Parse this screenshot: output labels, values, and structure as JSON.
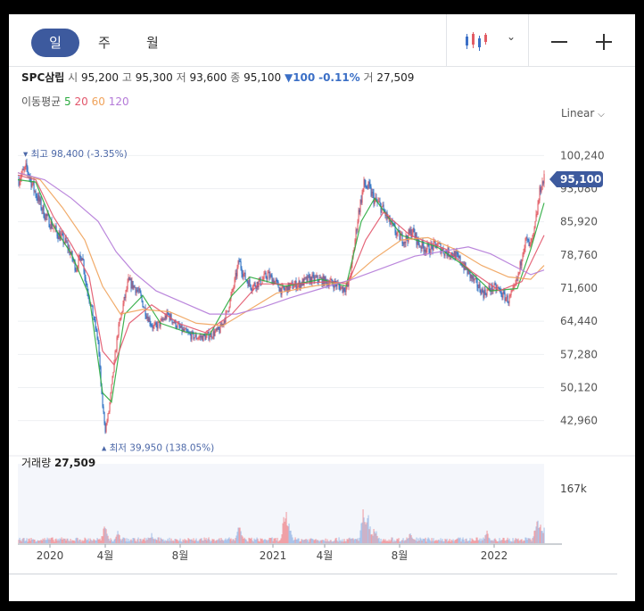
{
  "tabs": {
    "day": "일",
    "week": "주",
    "month": "월"
  },
  "icons": {
    "chart_type": "candlestick-icon",
    "chart_type_dropdown": "chevron-down-icon",
    "zoom_out": "minus-icon",
    "zoom_in": "plus-icon"
  },
  "header": {
    "name": "SPC삼립",
    "open_label": "시",
    "open": "95,200",
    "high_label": "고",
    "high": "95,300",
    "low_label": "저",
    "low": "93,600",
    "close_label": "종",
    "close": "95,100",
    "change_arrow": "▼",
    "change": "100",
    "change_pct": "-0.11%",
    "volume_label": "거",
    "volume": "27,509"
  },
  "moving_average": {
    "label": "이동평균",
    "periods": [
      "5",
      "20",
      "60",
      "120"
    ],
    "colors": [
      "#2bab3f",
      "#e2566b",
      "#f0a25a",
      "#b47ad8"
    ]
  },
  "scale": {
    "label": "Linear"
  },
  "colors": {
    "up": "#e25c64",
    "down": "#2b6fc2",
    "price_tag": "#3d5a9e",
    "tab_active": "#3d5a9e",
    "marker_text": "#4c68a8"
  },
  "chart_data": {
    "type": "candlestick",
    "x_axis_labels": [
      "2020",
      "4월",
      "8월",
      "2021",
      "4월",
      "8월",
      "2022"
    ],
    "y_axis_ticks": [
      100240,
      93080,
      85920,
      78760,
      71600,
      64440,
      57280,
      50120,
      42960
    ],
    "y_axis_tick_labels": [
      "100,240",
      "93,080",
      "85,920",
      "78,760",
      "71,600",
      "64,440",
      "57,280",
      "50,120",
      "42,960"
    ],
    "ylim": [
      37500,
      103000
    ],
    "current_price": 95100,
    "current_price_label": "95,100",
    "high_marker": {
      "value": 98400,
      "label": "최고",
      "value_label": "98,400",
      "pct": "(-3.35%)"
    },
    "low_marker": {
      "value": 39950,
      "label": "최저",
      "value_label": "39,950",
      "pct": "(138.05%)"
    },
    "close_path": [
      [
        0,
        95000
      ],
      [
        10,
        97500
      ],
      [
        18,
        93000
      ],
      [
        30,
        87500
      ],
      [
        42,
        84000
      ],
      [
        55,
        81000
      ],
      [
        65,
        76000
      ],
      [
        72,
        79000
      ],
      [
        76,
        73000
      ],
      [
        84,
        66000
      ],
      [
        90,
        60000
      ],
      [
        94,
        48000
      ],
      [
        98,
        41000
      ],
      [
        102,
        45000
      ],
      [
        106,
        52000
      ],
      [
        112,
        62000
      ],
      [
        118,
        68000
      ],
      [
        124,
        73000
      ],
      [
        130,
        72000
      ],
      [
        136,
        70500
      ],
      [
        144,
        66000
      ],
      [
        152,
        63000
      ],
      [
        160,
        64000
      ],
      [
        168,
        66000
      ],
      [
        176,
        64000
      ],
      [
        184,
        62500
      ],
      [
        192,
        61500
      ],
      [
        200,
        61000
      ],
      [
        208,
        61000
      ],
      [
        216,
        61500
      ],
      [
        226,
        62500
      ],
      [
        234,
        66000
      ],
      [
        242,
        72000
      ],
      [
        248,
        77500
      ],
      [
        254,
        74000
      ],
      [
        262,
        72000
      ],
      [
        272,
        73000
      ],
      [
        280,
        74500
      ],
      [
        288,
        73000
      ],
      [
        296,
        71000
      ],
      [
        306,
        72000
      ],
      [
        316,
        72500
      ],
      [
        326,
        73500
      ],
      [
        336,
        73500
      ],
      [
        346,
        73000
      ],
      [
        356,
        72500
      ],
      [
        364,
        71500
      ],
      [
        370,
        72000
      ],
      [
        374,
        76000
      ],
      [
        378,
        82000
      ],
      [
        382,
        88000
      ],
      [
        388,
        94000
      ],
      [
        394,
        93000
      ],
      [
        400,
        90500
      ],
      [
        408,
        89000
      ],
      [
        416,
        86000
      ],
      [
        426,
        83000
      ],
      [
        434,
        82000
      ],
      [
        442,
        84000
      ],
      [
        450,
        81000
      ],
      [
        460,
        80000
      ],
      [
        470,
        81000
      ],
      [
        478,
        79500
      ],
      [
        488,
        79000
      ],
      [
        496,
        77500
      ],
      [
        506,
        74500
      ],
      [
        514,
        72500
      ],
      [
        522,
        70500
      ],
      [
        530,
        71500
      ],
      [
        538,
        71500
      ],
      [
        544,
        70000
      ],
      [
        550,
        69000
      ],
      [
        556,
        71000
      ],
      [
        562,
        75000
      ],
      [
        566,
        80000
      ],
      [
        570,
        82000
      ],
      [
        574,
        80500
      ],
      [
        578,
        82500
      ],
      [
        582,
        88000
      ],
      [
        586,
        93500
      ],
      [
        590,
        95100
      ]
    ],
    "ma_series": [
      {
        "period": "5",
        "values": [
          [
            0,
            95000
          ],
          [
            20,
            94500
          ],
          [
            40,
            85000
          ],
          [
            60,
            79000
          ],
          [
            80,
            70000
          ],
          [
            95,
            49000
          ],
          [
            105,
            47000
          ],
          [
            120,
            66000
          ],
          [
            140,
            70000
          ],
          [
            160,
            64000
          ],
          [
            190,
            62000
          ],
          [
            215,
            61500
          ],
          [
            240,
            70000
          ],
          [
            260,
            74000
          ],
          [
            300,
            72000
          ],
          [
            340,
            73500
          ],
          [
            368,
            72000
          ],
          [
            385,
            86000
          ],
          [
            400,
            91000
          ],
          [
            430,
            83000
          ],
          [
            470,
            80500
          ],
          [
            500,
            76500
          ],
          [
            530,
            71000
          ],
          [
            560,
            71500
          ],
          [
            575,
            80000
          ],
          [
            590,
            90000
          ]
        ]
      },
      {
        "period": "20",
        "values": [
          [
            0,
            96000
          ],
          [
            20,
            95000
          ],
          [
            40,
            87000
          ],
          [
            60,
            81000
          ],
          [
            80,
            74000
          ],
          [
            95,
            58000
          ],
          [
            108,
            55000
          ],
          [
            125,
            64000
          ],
          [
            150,
            68000
          ],
          [
            180,
            64000
          ],
          [
            210,
            62000
          ],
          [
            240,
            66000
          ],
          [
            270,
            72500
          ],
          [
            310,
            72500
          ],
          [
            350,
            73000
          ],
          [
            370,
            72500
          ],
          [
            390,
            82000
          ],
          [
            410,
            88000
          ],
          [
            440,
            83000
          ],
          [
            480,
            80000
          ],
          [
            510,
            75000
          ],
          [
            540,
            71000
          ],
          [
            565,
            73000
          ],
          [
            590,
            83000
          ]
        ]
      },
      {
        "period": "60",
        "values": [
          [
            0,
            96500
          ],
          [
            25,
            95000
          ],
          [
            50,
            89000
          ],
          [
            75,
            82000
          ],
          [
            95,
            72000
          ],
          [
            115,
            66000
          ],
          [
            140,
            67000
          ],
          [
            170,
            66500
          ],
          [
            200,
            64000
          ],
          [
            230,
            63500
          ],
          [
            260,
            67000
          ],
          [
            290,
            70500
          ],
          [
            330,
            72000
          ],
          [
            370,
            73000
          ],
          [
            400,
            78000
          ],
          [
            430,
            82000
          ],
          [
            460,
            82500
          ],
          [
            490,
            80000
          ],
          [
            520,
            76500
          ],
          [
            550,
            74000
          ],
          [
            575,
            73500
          ],
          [
            590,
            76500
          ]
        ]
      },
      {
        "period": "120",
        "values": [
          [
            0,
            96500
          ],
          [
            30,
            95000
          ],
          [
            60,
            91000
          ],
          [
            90,
            86000
          ],
          [
            110,
            79500
          ],
          [
            130,
            75000
          ],
          [
            155,
            71000
          ],
          [
            185,
            68500
          ],
          [
            215,
            66000
          ],
          [
            245,
            66000
          ],
          [
            275,
            67500
          ],
          [
            305,
            69500
          ],
          [
            340,
            71500
          ],
          [
            375,
            73500
          ],
          [
            410,
            76000
          ],
          [
            445,
            78500
          ],
          [
            475,
            79500
          ],
          [
            505,
            80500
          ],
          [
            530,
            79000
          ],
          [
            555,
            76500
          ],
          [
            575,
            74500
          ],
          [
            590,
            75500
          ]
        ]
      }
    ],
    "volume_label": "거래량",
    "volume_value": "27,509",
    "volume_axis_label": "167k",
    "volume_max": 167000,
    "volume_spikes": [
      [
        98,
        60000
      ],
      [
        112,
        35000
      ],
      [
        150,
        28000
      ],
      [
        248,
        55000
      ],
      [
        300,
        110000
      ],
      [
        304,
        55000
      ],
      [
        388,
        115000
      ],
      [
        392,
        95000
      ],
      [
        400,
        50000
      ],
      [
        440,
        30000
      ],
      [
        526,
        35000
      ],
      [
        582,
        85000
      ],
      [
        586,
        55000
      ],
      [
        590,
        45000
      ]
    ]
  }
}
